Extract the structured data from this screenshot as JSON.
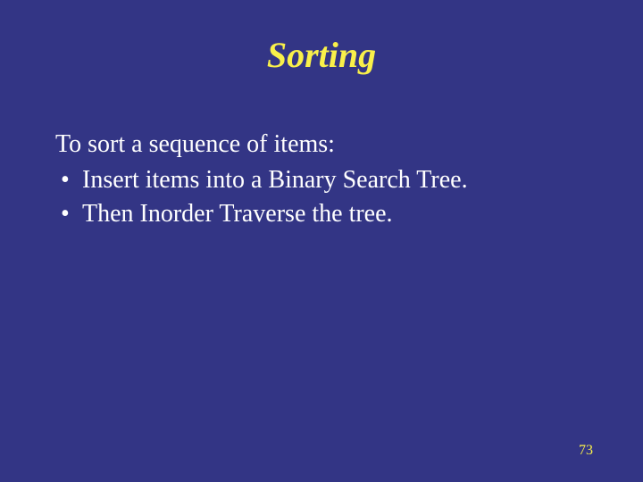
{
  "title": "Sorting",
  "lead": "To sort a sequence of items:",
  "bullets": [
    "Insert items into a Binary Search Tree.",
    "Then Inorder Traverse the tree."
  ],
  "page_number": "73",
  "colors": {
    "background": "#333585",
    "title": "#f9f04a",
    "body_text": "#ffffff"
  }
}
